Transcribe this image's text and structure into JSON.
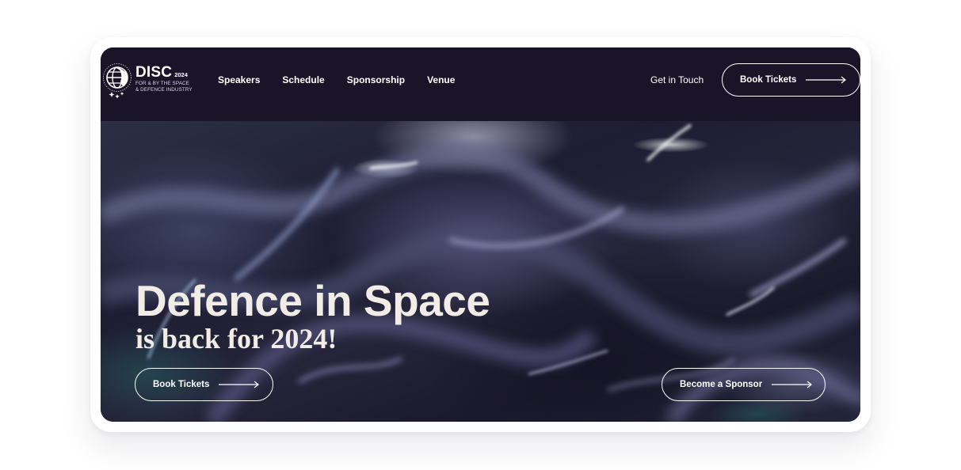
{
  "logo": {
    "title": "DISC",
    "year": "2024",
    "tagline_line1": "FOR & BY THE SPACE",
    "tagline_line2": "& DEFENCE INDUSTRY",
    "icon": "globe-icon"
  },
  "nav": {
    "links": [
      {
        "label": "Speakers"
      },
      {
        "label": "Schedule"
      },
      {
        "label": "Sponsorship"
      },
      {
        "label": "Venue"
      }
    ],
    "contact_label": "Get in Touch",
    "cta_label": "Book Tickets",
    "cta_icon": "arrow-right-icon"
  },
  "hero": {
    "title": "Defence in Space",
    "subtitle": "is back for 2024!",
    "primary_cta_label": "Book Tickets",
    "secondary_cta_label": "Become a Sponsor",
    "cta_icon": "arrow-right-icon"
  },
  "colors": {
    "navbar_bg": "#1a1428",
    "hero_text": "#f1ece6",
    "frame_bg": "#ffffff"
  }
}
